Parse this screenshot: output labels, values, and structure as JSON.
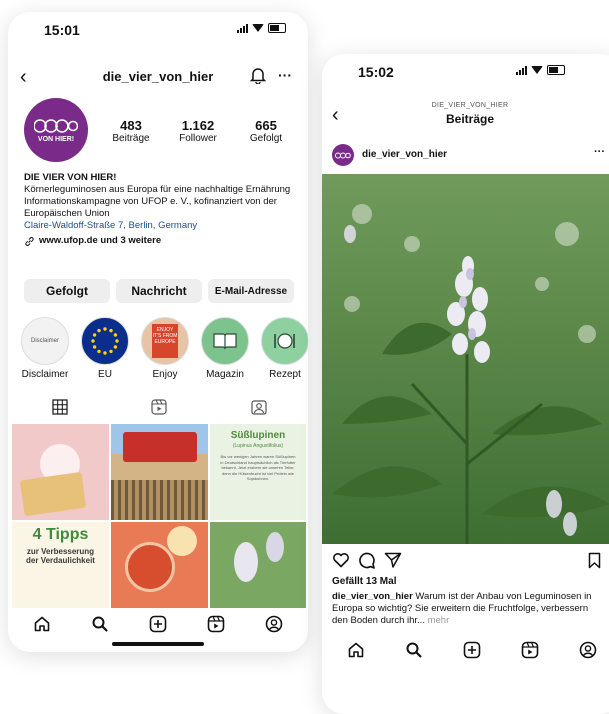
{
  "profile": {
    "status_time": "15:01",
    "username": "die_vier_von_hier",
    "logo_text": "VON HIER!",
    "stats": [
      {
        "value": "483",
        "label": "Beiträge"
      },
      {
        "value": "1.162",
        "label": "Follower"
      },
      {
        "value": "665",
        "label": "Gefolgt"
      }
    ],
    "display_name": "DIE VIER VON HIER!",
    "bio_line1": "Körnerleguminosen aus Europa für eine nachhaltige Ernährung",
    "bio_line2": "Informationskampagne von UFOP e. V., kofinanziert von der Europäischen Union",
    "address": "Claire-Waldoff-Straße 7, Berlin, Germany",
    "link": "www.ufop.de und 3 weitere",
    "buttons": {
      "following": "Gefolgt",
      "message": "Nachricht",
      "email": "E-Mail-Adresse"
    },
    "highlights": [
      {
        "label": "Disclaimer",
        "inner": "Disclaimer"
      },
      {
        "label": "EU"
      },
      {
        "label": "Enjoy",
        "inner": "ENJOY IT'S FROM EUROPE"
      },
      {
        "label": "Magazin"
      },
      {
        "label": "Rezept"
      }
    ],
    "grid": {
      "tile3_title": "Süßlupinen",
      "tile3_subtitle": "(Lupinus Angustifolius)",
      "tile3_body": "Bis vor wenigen Jahren waren Süßlupinen in Deutschland hauptsächlich als Tierfutter bekannt. Jetzt erobern sie unseren Teller, denn die Hülsenfrucht ist viel Protein wie Sojabohnen.",
      "tile4_big": "4 Tipps",
      "tile4_small": "zur Verbesserung der Verdaulichkeit"
    }
  },
  "post": {
    "status_time": "15:02",
    "header_user": "DIE_VIER_VON_HIER",
    "header_title": "Beiträge",
    "author": "die_vier_von_hier",
    "likes": "Gefällt 13 Mal",
    "caption_user": "die_vier_von_hier",
    "caption_text": " Warum ist der Anbau von Leguminosen in Europa so wichtig? Sie erweitern die Fruchtfolge, verbessern den Boden durch ihr...",
    "more": " mehr",
    "more_icon": "···"
  },
  "colors": {
    "brand_purple": "#7a2a88",
    "link_blue": "#1a4f8b",
    "leaf_green": "#4e8a3a"
  }
}
